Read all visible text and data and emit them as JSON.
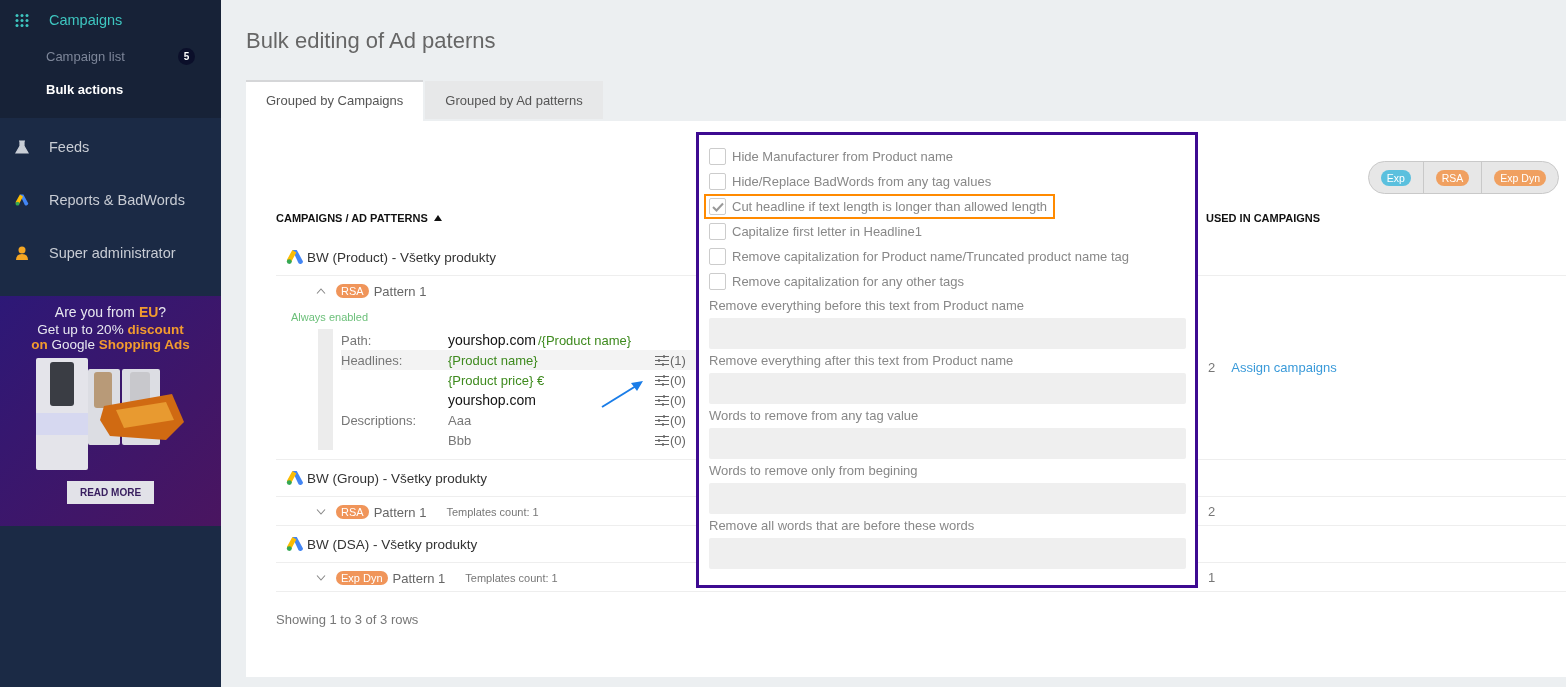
{
  "sidebar": {
    "menu": [
      {
        "label": "Campaigns",
        "active": true,
        "children": [
          {
            "label": "Campaign list",
            "badge": "5",
            "selected": false
          },
          {
            "label": "Bulk actions",
            "selected": true
          }
        ]
      },
      {
        "label": "Feeds",
        "active": false
      },
      {
        "label": "Reports & BadWords",
        "active": false
      },
      {
        "label": "Super administrator",
        "active": false
      }
    ],
    "promo": {
      "question": "Are you from **EU**?",
      "offer_lines": [
        "Get up to 20% **discount**",
        "**on** Google **Shopping Ads**"
      ],
      "picture": {
        "kind": "picture"
      },
      "button": "READ MORE"
    }
  },
  "page_title": "Bulk editing of Ad paterns",
  "tabs": [
    {
      "label": "Grouped by Campaigns",
      "selected": true
    },
    {
      "label": "Grouped by Ad patterns",
      "selected": false
    }
  ],
  "type_filter": [
    {
      "label": "Exp",
      "color": "#5bc0de"
    },
    {
      "label": "RSA",
      "color": "#f0a060"
    },
    {
      "label": "Exp Dyn",
      "color": "#f0a060"
    }
  ],
  "table": {
    "columns": [
      {
        "label": "CAMPAIGNS / AD PATTERNS",
        "sort_ascending": true
      },
      {
        "label": "USED IN CAMPAIGNS"
      }
    ],
    "rows": [
      {
        "campaign": "BW (Product) - Všetky produkty",
        "patterns": [
          {
            "type": "RSA",
            "color": "#f0955a",
            "name": "Pattern 1",
            "expanded": true,
            "status": "Always enabled",
            "used": "2",
            "action": "Assign campaigns",
            "details": {
              "path": {
                "label": "Path:",
                "domain": "yourshop.com",
                "suffix": "/{Product name}"
              },
              "groups": [
                {
                  "label": "Headlines:",
                  "items": [
                    {
                      "text": "{Product name}",
                      "kind": "tag",
                      "count": "(1)",
                      "selected": true
                    },
                    {
                      "text": "{Product price} €",
                      "kind": "tag",
                      "count": "(0)",
                      "selected": false
                    },
                    {
                      "text": "yourshop.com",
                      "kind": "domain",
                      "count": "(0)",
                      "selected": false
                    }
                  ]
                },
                {
                  "label": "Descriptions:",
                  "items": [
                    {
                      "text": "Aaa",
                      "kind": "plain",
                      "count": "(0)",
                      "selected": false
                    },
                    {
                      "text": "Bbb",
                      "kind": "plain",
                      "count": "(0)",
                      "selected": false
                    }
                  ]
                }
              ]
            }
          }
        ]
      },
      {
        "campaign": "BW (Group) - Všetky produkty",
        "patterns": [
          {
            "type": "RSA",
            "color": "#f0955a",
            "name": "Pattern 1",
            "expanded": false,
            "templates_count": "Templates count: 1",
            "used": "2"
          }
        ]
      },
      {
        "campaign": "BW (DSA) - Všetky produkty",
        "patterns": [
          {
            "type": "Exp Dyn",
            "color": "#f0955a",
            "name": "Pattern 1",
            "expanded": false,
            "templates_count": "Templates count: 1",
            "used": "1"
          }
        ]
      }
    ]
  },
  "footer": "Showing 1 to 3 of 3 rows",
  "options_popup": {
    "checkboxes": [
      {
        "label": "Hide Manufacturer from Product name",
        "checked": false,
        "highlighted": false
      },
      {
        "label": "Hide/Replace BadWords from any tag values",
        "checked": false,
        "highlighted": false
      },
      {
        "label": "Cut headline if text length is longer than allowed length",
        "checked": true,
        "highlighted": true
      },
      {
        "label": "Capitalize first letter in Headline1",
        "checked": false,
        "highlighted": false
      },
      {
        "label": "Remove capitalization for Product name/Truncated product name tag",
        "checked": false,
        "highlighted": false
      },
      {
        "label": "Remove capitalization for any other tags",
        "checked": false,
        "highlighted": false
      }
    ],
    "fields": [
      {
        "label": "Remove everything before this text from Product name"
      },
      {
        "label": "Remove everything after this text from Product name"
      },
      {
        "label": "Words to remove from any tag value"
      },
      {
        "label": "Words to remove only from begining"
      },
      {
        "label": "Remove all words that are before these words"
      }
    ]
  }
}
